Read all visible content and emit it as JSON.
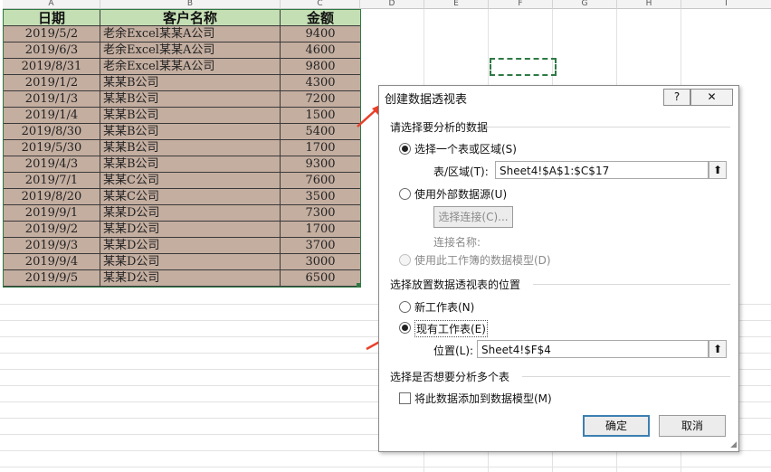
{
  "columns": [
    "A",
    "B",
    "C",
    "D",
    "E",
    "F",
    "G",
    "H",
    "I"
  ],
  "table": {
    "headers": [
      "日期",
      "客户名称",
      "金额"
    ],
    "rows": [
      [
        "2019/5/2",
        "老余Excel某某A公司",
        "9400"
      ],
      [
        "2019/6/3",
        "老余Excel某某A公司",
        "4600"
      ],
      [
        "2019/8/31",
        "老余Excel某某A公司",
        "9800"
      ],
      [
        "2019/1/2",
        "某某B公司",
        "4300"
      ],
      [
        "2019/1/3",
        "某某B公司",
        "7200"
      ],
      [
        "2019/1/4",
        "某某B公司",
        "1500"
      ],
      [
        "2019/8/30",
        "某某B公司",
        "5400"
      ],
      [
        "2019/5/30",
        "某某B公司",
        "1700"
      ],
      [
        "2019/4/3",
        "某某B公司",
        "9300"
      ],
      [
        "2019/7/1",
        "某某C公司",
        "7600"
      ],
      [
        "2019/8/20",
        "某某C公司",
        "3500"
      ],
      [
        "2019/9/1",
        "某某D公司",
        "7300"
      ],
      [
        "2019/9/2",
        "某某D公司",
        "1700"
      ],
      [
        "2019/9/3",
        "某某D公司",
        "3700"
      ],
      [
        "2019/9/4",
        "某某D公司",
        "3000"
      ],
      [
        "2019/9/5",
        "某某D公司",
        "6500"
      ]
    ]
  },
  "dialog": {
    "title": "创建数据透视表",
    "help": "?",
    "close": "✕",
    "section1": "请选择要分析的数据",
    "opt_table": "选择一个表或区域(S)",
    "range_label": "表/区域(T):",
    "range_value": "Sheet4!$A$1:$C$17",
    "opt_external": "使用外部数据源(U)",
    "choose_conn": "选择连接(C)...",
    "conn_name": "连接名称:",
    "opt_model": "使用此工作簿的数据模型(D)",
    "section2": "选择放置数据透视表的位置",
    "opt_new": "新工作表(N)",
    "opt_existing": "现有工作表(E)",
    "location_label": "位置(L):",
    "location_value": "Sheet4!$F$4",
    "section3": "选择是否想要分析多个表",
    "add_model": "将此数据添加到数据模型(M)",
    "ok": "确定",
    "cancel": "取消"
  },
  "colors": {
    "accent": "#2e7a45",
    "arrow": "#e8412c",
    "cell_bg": "#c4aea0",
    "header_bg": "#c5dfb4"
  }
}
